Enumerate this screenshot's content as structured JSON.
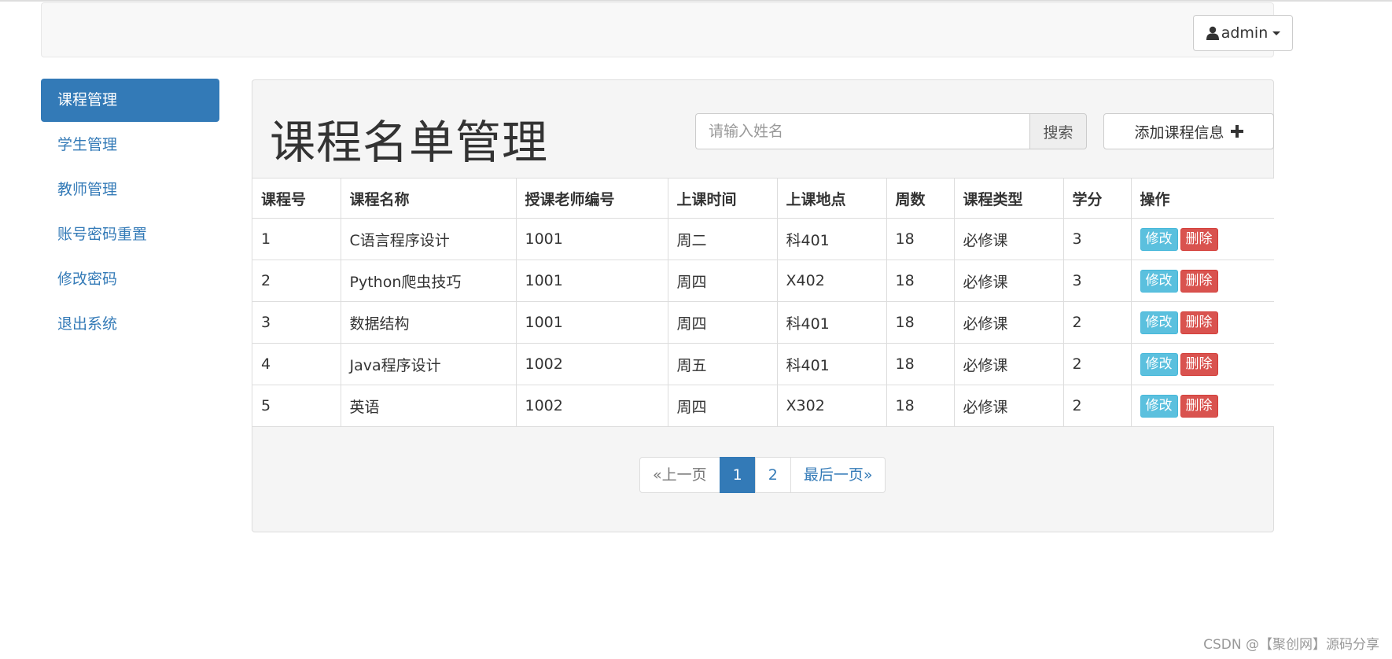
{
  "navbar": {
    "user_label": "admin"
  },
  "sidebar": {
    "items": [
      {
        "label": "课程管理",
        "active": true
      },
      {
        "label": "学生管理"
      },
      {
        "label": "教师管理"
      },
      {
        "label": "账号密码重置"
      },
      {
        "label": "修改密码"
      },
      {
        "label": "退出系统"
      }
    ]
  },
  "main": {
    "title": "课程名单管理",
    "search": {
      "placeholder": "请输入姓名",
      "value": "",
      "button_label": "搜索"
    },
    "add_button_label": "添加课程信息",
    "table": {
      "headers": [
        "课程号",
        "课程名称",
        "授课老师编号",
        "上课时间",
        "上课地点",
        "周数",
        "课程类型",
        "学分",
        "操作"
      ],
      "rows": [
        [
          "1",
          "C语言程序设计",
          "1001",
          "周二",
          "科401",
          "18",
          "必修课",
          "3"
        ],
        [
          "2",
          "Python爬虫技巧",
          "1001",
          "周四",
          "X402",
          "18",
          "必修课",
          "3"
        ],
        [
          "3",
          "数据结构",
          "1001",
          "周四",
          "科401",
          "18",
          "必修课",
          "2"
        ],
        [
          "4",
          "Java程序设计",
          "1002",
          "周五",
          "科401",
          "18",
          "必修课",
          "2"
        ],
        [
          "5",
          "英语",
          "1002",
          "周四",
          "X302",
          "18",
          "必修课",
          "2"
        ]
      ],
      "edit_label": "修改",
      "delete_label": "删除"
    },
    "pagination": {
      "prev": "«上一页",
      "pages": [
        "1",
        "2"
      ],
      "current": "1",
      "last": "最后一页»"
    }
  },
  "watermark": "CSDN @【聚创网】源码分享",
  "colors": {
    "primary": "#337ab7",
    "info": "#5bc0de",
    "danger": "#d9534f",
    "panel_bg": "#f5f5f5"
  }
}
